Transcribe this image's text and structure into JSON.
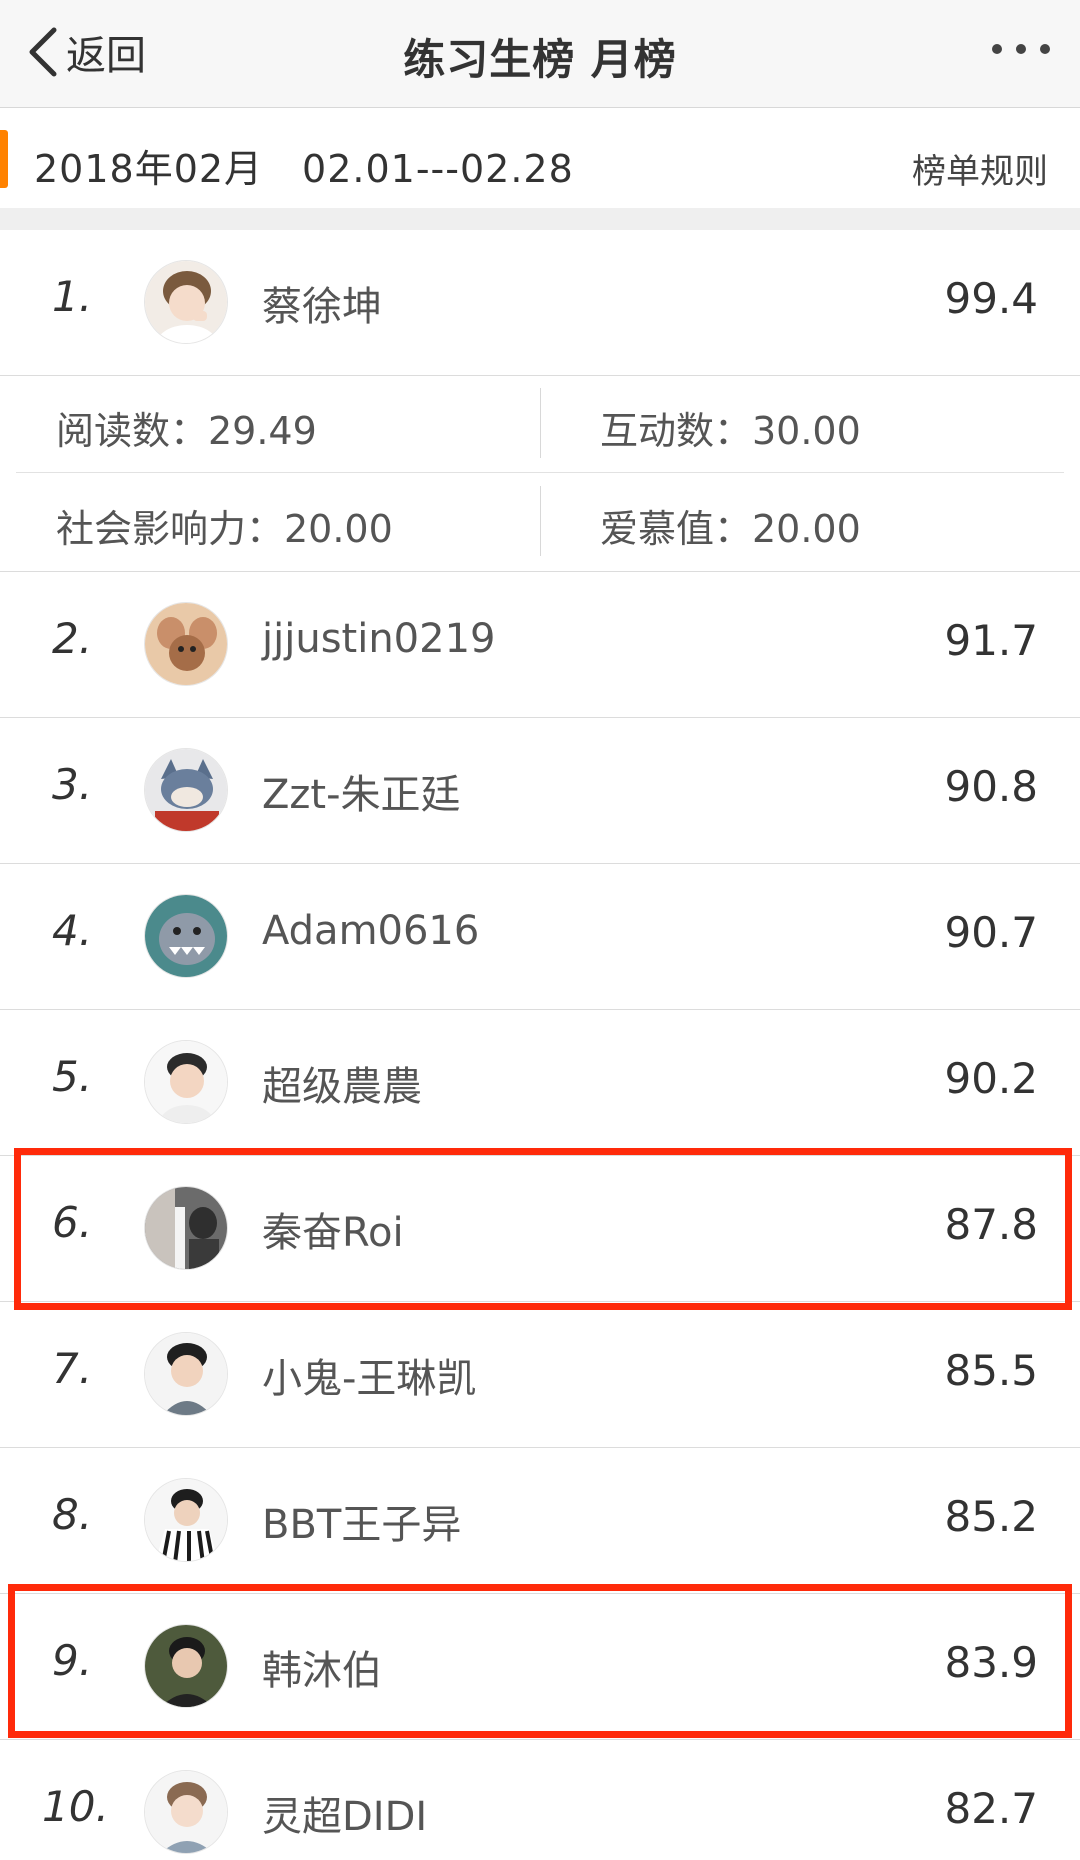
{
  "nav": {
    "back_label": "返回",
    "title": "练习生榜 月榜"
  },
  "period": {
    "label": "2018年02月　02.01---02.28",
    "rules_label": "榜单规则"
  },
  "stats": {
    "reads": "阅读数：29.49",
    "interactions": "互动数：30.00",
    "influence": "社会影响力：20.00",
    "affection": "爱慕值：20.00"
  },
  "rankings": [
    {
      "rank": "1.",
      "name": "蔡徐坤",
      "score": "99.4"
    },
    {
      "rank": "2.",
      "name": "jjjustin0219",
      "score": "91.7"
    },
    {
      "rank": "3.",
      "name": "Zzt-朱正廷",
      "score": "90.8"
    },
    {
      "rank": "4.",
      "name": "Adam0616",
      "score": "90.7"
    },
    {
      "rank": "5.",
      "name": "超级農農",
      "score": "90.2"
    },
    {
      "rank": "6.",
      "name": "秦奋Roi",
      "score": "87.8"
    },
    {
      "rank": "7.",
      "name": "小鬼-王琳凯",
      "score": "85.5"
    },
    {
      "rank": "8.",
      "name": "BBT王子异",
      "score": "85.2"
    },
    {
      "rank": "9.",
      "name": "韩沐伯",
      "score": "83.9"
    },
    {
      "rank": "10.",
      "name": "灵超DIDI",
      "score": "82.7"
    }
  ],
  "colors": {
    "accent": "#ff8200",
    "highlight": "#ff2a0a"
  }
}
